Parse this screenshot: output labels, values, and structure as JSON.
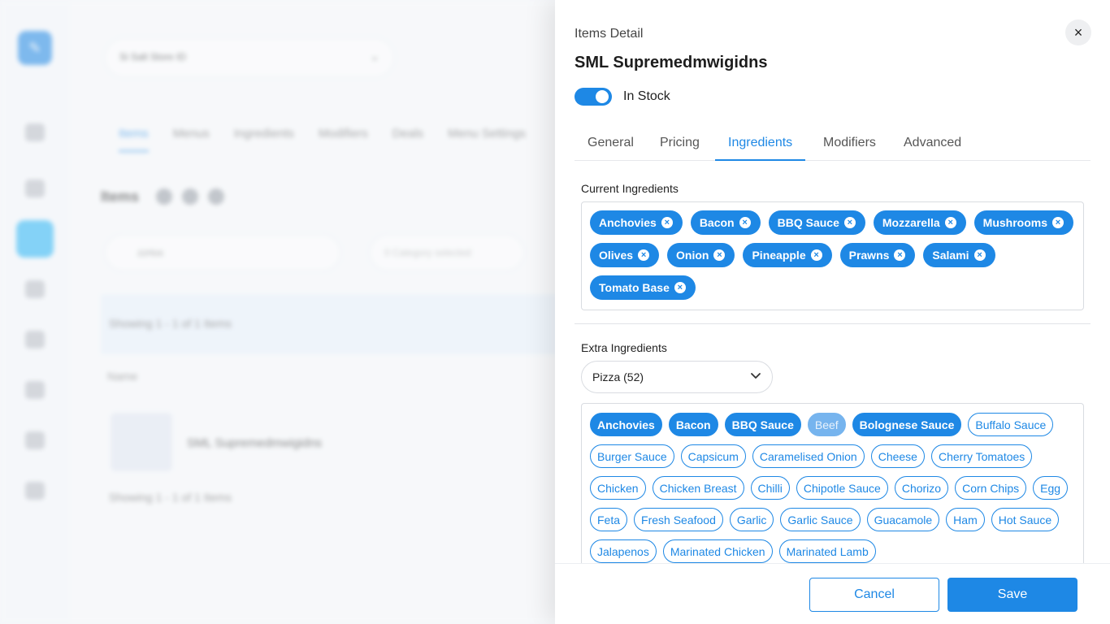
{
  "background": {
    "store_label": "Si Salt Store ID",
    "tabs": [
      "Items",
      "Menus",
      "Ingredients",
      "Modifiers",
      "Deals",
      "Menu Settings"
    ],
    "items_title": "Items",
    "search_value": "zzrtos",
    "filter_placeholder": "0 Category selected",
    "banner_text": "Showing 1 - 1 of 1 Items",
    "column_name": "Name",
    "row_name": "SML Supremedmwigidns",
    "footer_text": "Showing 1 - 1 of 1 Items"
  },
  "drawer": {
    "subtitle": "Items Detail",
    "title": "SML Supremedmwigidns",
    "close_label": "×",
    "in_stock_label": "In Stock",
    "in_stock": true,
    "tabs": [
      {
        "label": "General"
      },
      {
        "label": "Pricing"
      },
      {
        "label": "Ingredients",
        "active": true
      },
      {
        "label": "Modifiers"
      },
      {
        "label": "Advanced"
      }
    ],
    "current_ingredients": {
      "label": "Current Ingredients",
      "items": [
        "Anchovies",
        "Bacon",
        "BBQ Sauce",
        "Mozzarella",
        "Mushrooms",
        "Olives",
        "Onion",
        "Pineapple",
        "Prawns",
        "Salami",
        "Tomato Base"
      ]
    },
    "extra_ingredients": {
      "label": "Extra Ingredients",
      "category_select": "Pizza (52)",
      "items": [
        {
          "label": "Anchovies",
          "state": "selected"
        },
        {
          "label": "Bacon",
          "state": "selected"
        },
        {
          "label": "BBQ Sauce",
          "state": "selected"
        },
        {
          "label": "Beef",
          "state": "disabled"
        },
        {
          "label": "Bolognese Sauce",
          "state": "selected"
        },
        {
          "label": "Buffalo Sauce",
          "state": "normal"
        },
        {
          "label": "Burger Sauce",
          "state": "normal"
        },
        {
          "label": "Capsicum",
          "state": "normal"
        },
        {
          "label": "Caramelised Onion",
          "state": "normal"
        },
        {
          "label": "Cheese",
          "state": "normal"
        },
        {
          "label": "Cherry Tomatoes",
          "state": "normal"
        },
        {
          "label": "Chicken",
          "state": "normal"
        },
        {
          "label": "Chicken Breast",
          "state": "normal"
        },
        {
          "label": "Chilli",
          "state": "normal"
        },
        {
          "label": "Chipotle Sauce",
          "state": "normal"
        },
        {
          "label": "Chorizo",
          "state": "normal"
        },
        {
          "label": "Corn Chips",
          "state": "normal"
        },
        {
          "label": "Egg",
          "state": "normal"
        },
        {
          "label": "Feta",
          "state": "normal"
        },
        {
          "label": "Fresh Seafood",
          "state": "normal"
        },
        {
          "label": "Garlic",
          "state": "normal"
        },
        {
          "label": "Garlic Sauce",
          "state": "normal"
        },
        {
          "label": "Guacamole",
          "state": "normal"
        },
        {
          "label": "Ham",
          "state": "normal"
        },
        {
          "label": "Hot Sauce",
          "state": "normal"
        },
        {
          "label": "Jalapenos",
          "state": "normal"
        },
        {
          "label": "Marinated Chicken",
          "state": "normal"
        },
        {
          "label": "Marinated Lamb",
          "state": "normal"
        }
      ]
    },
    "footer": {
      "cancel_label": "Cancel",
      "save_label": "Save"
    }
  },
  "colors": {
    "accent": "#1e88e5",
    "accent_disabled": "#76b4ee"
  }
}
